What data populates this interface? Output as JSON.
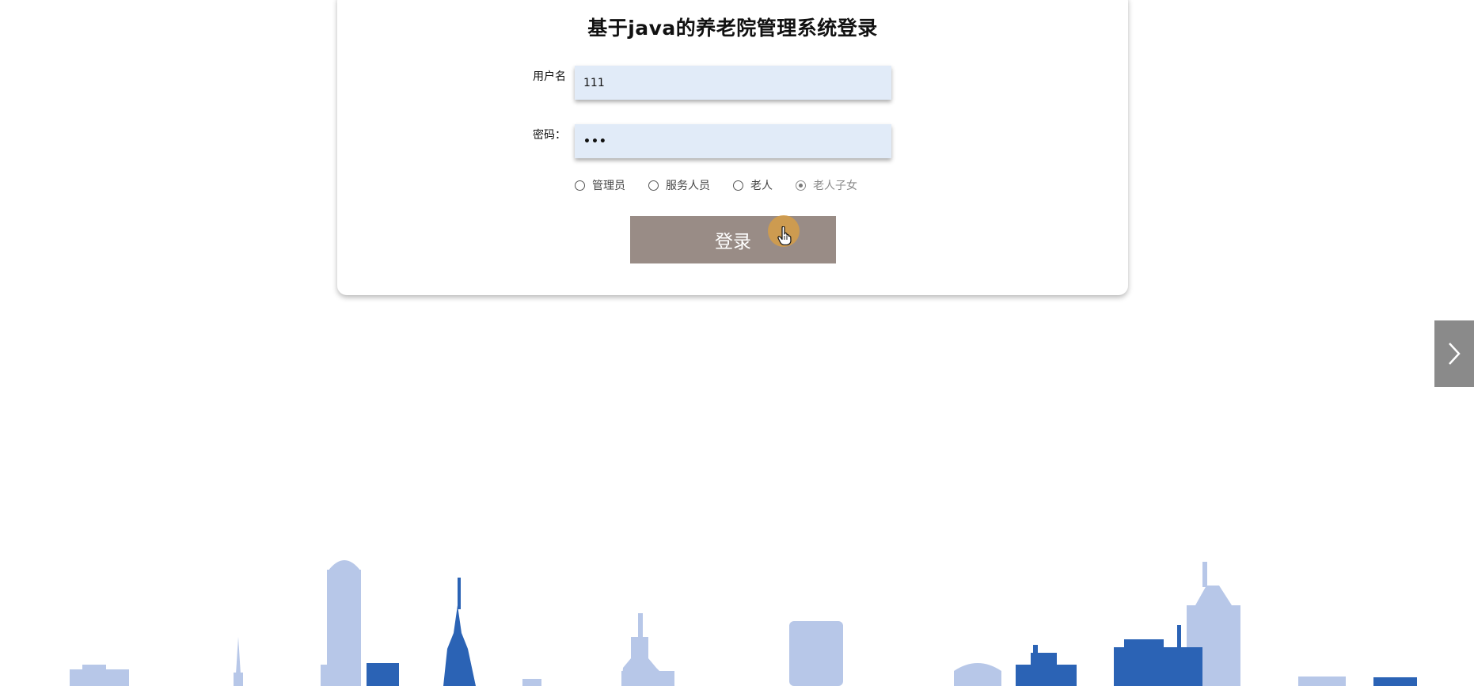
{
  "login": {
    "title": "基于java的养老院管理系统登录",
    "username_label": "用户名",
    "username_value": "111",
    "password_label": "密码：",
    "password_value": "•••",
    "roles": [
      {
        "label": "管理员",
        "checked": false
      },
      {
        "label": "服务人员",
        "checked": false
      },
      {
        "label": "老人",
        "checked": false
      },
      {
        "label": "老人子女",
        "checked": true
      }
    ],
    "submit_label": "登录"
  },
  "carousel": {
    "next_icon": "chevron-right-icon"
  },
  "colors": {
    "input_bg": "#e1ebf8",
    "button_bg": "#998c86",
    "skyline_dark": "#2b63b5",
    "skyline_light": "#b7c7e8",
    "arrow_bg": "#8a8a8a",
    "cursor_halo": "#d69e46"
  }
}
